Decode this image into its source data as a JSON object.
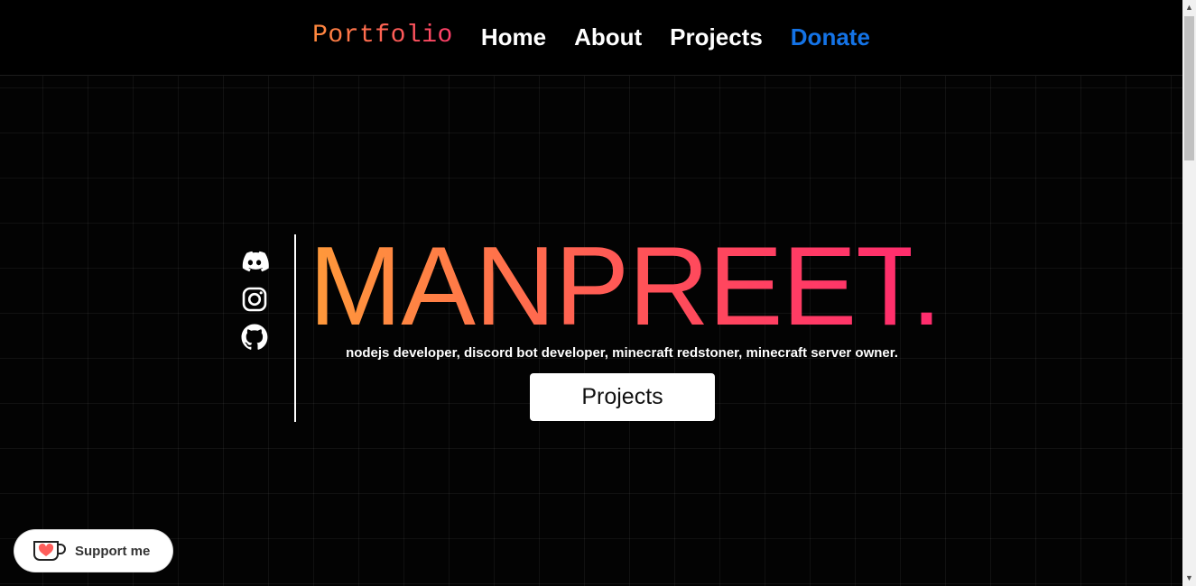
{
  "nav": {
    "brand": "Portfolio",
    "links": [
      "Home",
      "About",
      "Projects",
      "Donate"
    ]
  },
  "hero": {
    "name": "MANPREET",
    "dot": ".",
    "tagline": "nodejs developer, discord bot developer, minecraft redstoner, minecraft server owner.",
    "cta_label": "Projects",
    "socials": [
      "discord-icon",
      "instagram-icon",
      "github-icon"
    ]
  },
  "widget": {
    "support_label": "Support me",
    "icon": "ko-fi-cup-icon"
  },
  "colors": {
    "background": "#030303",
    "accent_orange": "#ff9a3a",
    "accent_pink": "#ff2d6d",
    "donate_blue": "#1473e6"
  }
}
